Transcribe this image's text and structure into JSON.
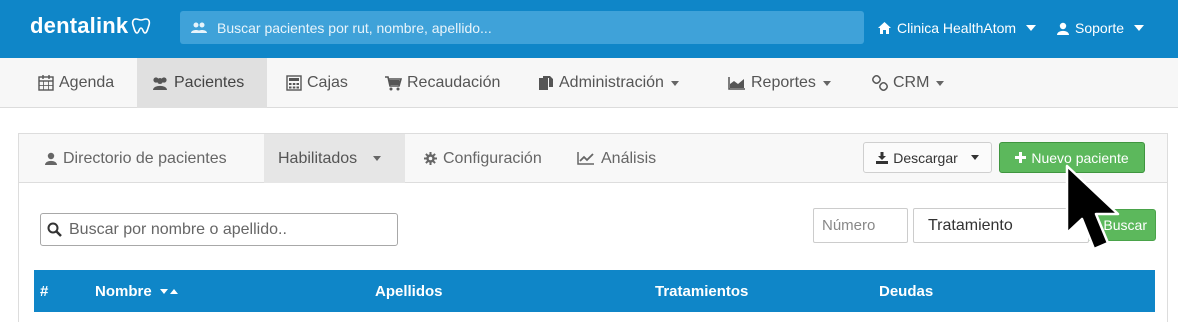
{
  "topbar": {
    "logo": "dentalink",
    "search_placeholder": "Buscar pacientes por rut, nombre, apellido...",
    "clinic": "Clinica HealthAtom",
    "user": "Soporte"
  },
  "nav": {
    "items": [
      {
        "label": "Agenda",
        "icon": "calendar-icon"
      },
      {
        "label": "Pacientes",
        "icon": "users-icon",
        "active": true
      },
      {
        "label": "Cajas",
        "icon": "calculator-icon"
      },
      {
        "label": "Recaudación",
        "icon": "cart-icon"
      },
      {
        "label": "Administración",
        "icon": "documents-icon",
        "dropdown": true
      },
      {
        "label": "Reportes",
        "icon": "area-chart-icon",
        "dropdown": true
      },
      {
        "label": "CRM",
        "icon": "link-icon",
        "dropdown": true
      }
    ]
  },
  "subnav": {
    "items": [
      {
        "label": "Directorio de pacientes",
        "icon": "user-icon"
      },
      {
        "label": "Habilitados",
        "active": true,
        "dropdown": true
      },
      {
        "label": "Configuración",
        "icon": "gear-icon"
      },
      {
        "label": "Análisis",
        "icon": "line-chart-icon"
      }
    ],
    "download_label": "Descargar",
    "new_patient_label": "Nuevo paciente"
  },
  "filters": {
    "search_placeholder": "Buscar por nombre o apellido..",
    "number_placeholder": "Número",
    "treatment_selected": "Tratamiento",
    "search_button": "Buscar"
  },
  "table": {
    "headers": [
      "#",
      "Nombre",
      "Apellidos",
      "Tratamientos",
      "Deudas"
    ]
  },
  "colors": {
    "brand_blue": "#0f86c8",
    "success_green": "#5cb85c"
  }
}
